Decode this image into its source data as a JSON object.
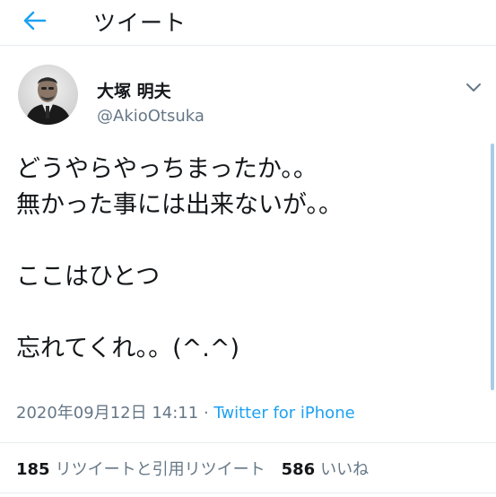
{
  "header": {
    "title": "ツイート",
    "back_icon": "arrow-left-icon",
    "accent": "#1da1f2"
  },
  "tweet": {
    "author": {
      "display_name": "大塚 明夫",
      "handle": "@AkioOtsuka"
    },
    "menu_icon": "chevron-down-icon",
    "lines": [
      "どうやらやっちまったか。。",
      "無かった事には出来ないが。。",
      "",
      "ここはひとつ",
      "",
      "忘れてくれ。。(^.^)"
    ],
    "timestamp": "2020年09月12日 14:11",
    "separator": " · ",
    "source": "Twitter for iPhone",
    "stats": {
      "retweets_count": "185",
      "retweets_label": "リツイートと引用リツイート",
      "likes_count": "586",
      "likes_label": "いいね"
    }
  }
}
